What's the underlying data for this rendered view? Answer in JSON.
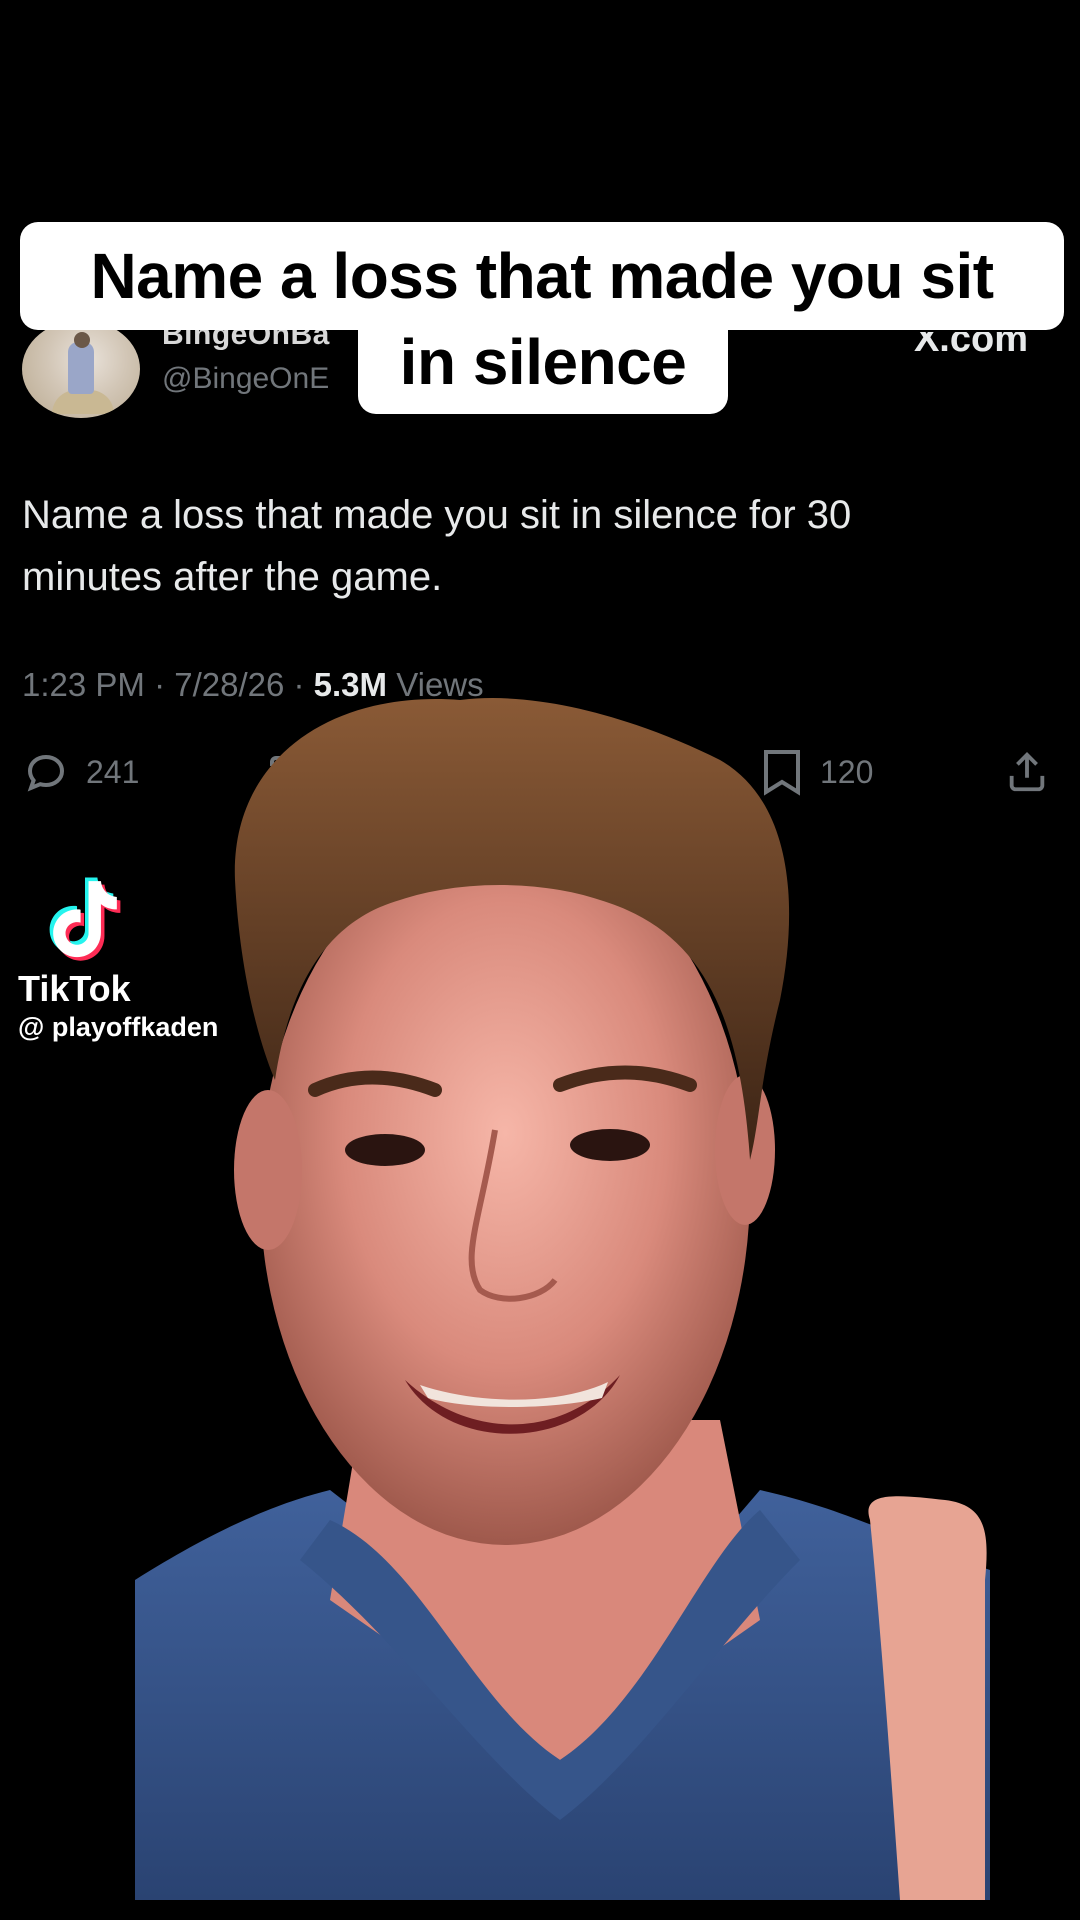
{
  "caption": {
    "line1": "Name a loss that made you sit",
    "line2": "in silence"
  },
  "tweet": {
    "display_name": "BingeOnBa",
    "handle": "@BingeOnE",
    "source_label": "X.com",
    "text": "Name a loss that made you sit in silence for 30 minutes after the game.",
    "meta_time_date": "1:23 PM · 7/28/26 ·",
    "meta_views_count": "5.3M",
    "meta_views_label": "Views",
    "replies": "241",
    "bookmarks": "120"
  },
  "watermark": {
    "app": "TikTok",
    "username": "@ playoffkaden"
  },
  "icons": [
    "reply-icon",
    "retweet-icon",
    "bookmark-icon",
    "share-icon",
    "tiktok-logo-icon"
  ],
  "colors": {
    "background": "#000000",
    "caption_bg": "#ffffff",
    "text_primary": "#e7e9ea",
    "text_secondary": "#71767b",
    "tiktok_cyan": "#25f4ee",
    "tiktok_red": "#fe2c55",
    "shirt": "#3a5a93"
  }
}
